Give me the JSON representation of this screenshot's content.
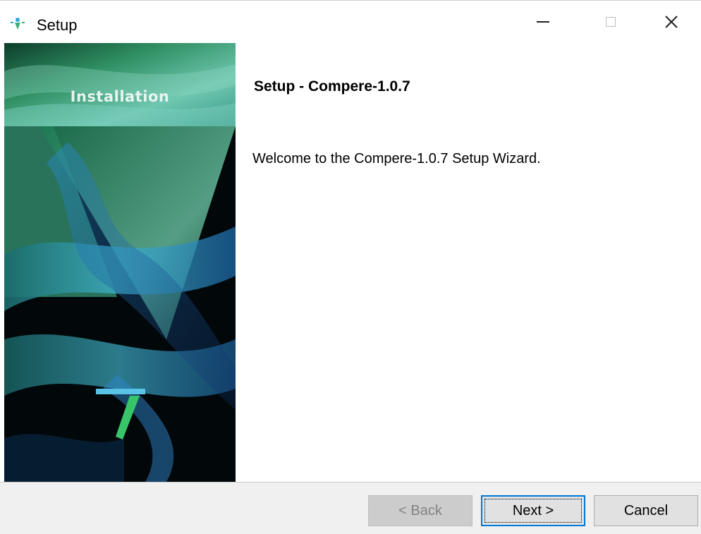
{
  "window": {
    "title": "Setup",
    "icon": "setup-app-icon",
    "controls": {
      "minimize": "minimize-icon",
      "maximize": "maximize-icon",
      "close_glyph": "✕"
    }
  },
  "banner": {
    "label": "Installation"
  },
  "content": {
    "heading": "Setup - Compere-1.0.7",
    "welcome": "Welcome to the Compere-1.0.7 Setup Wizard."
  },
  "buttons": {
    "back": "< Back",
    "next": "Next >",
    "cancel": "Cancel"
  },
  "colors": {
    "focus_border": "#0078d7",
    "footer_bg": "#f0f0f0",
    "banner_green": "#3aa57a",
    "banner_blue": "#2a8fd6"
  }
}
